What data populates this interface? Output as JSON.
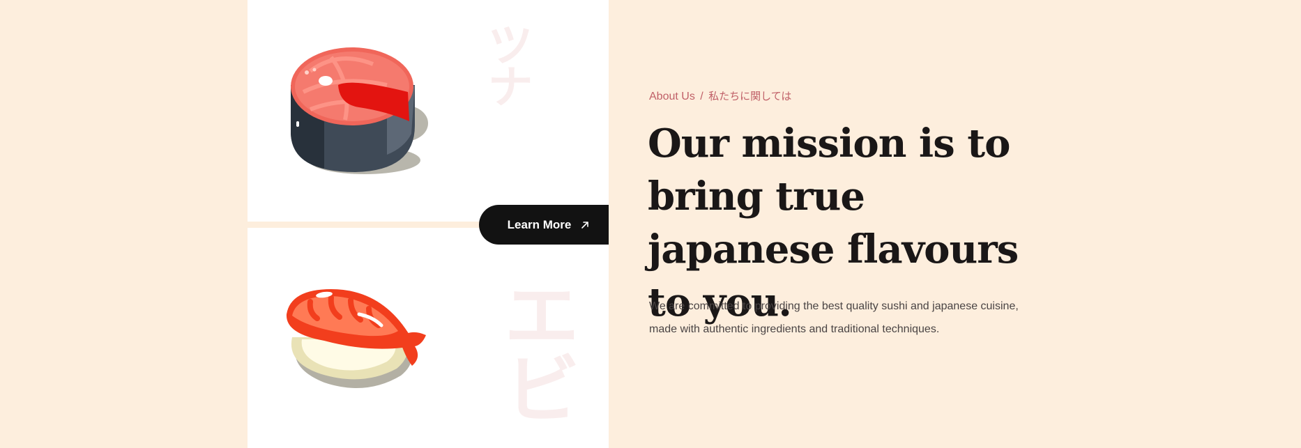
{
  "cards": {
    "top": {
      "kana": "ツナ",
      "food_icon": "tuna-steak-icon"
    },
    "bottom": {
      "kana": "エビ",
      "food_icon": "ebi-nigiri-icon"
    }
  },
  "cta": {
    "label": "Learn More",
    "icon": "arrow-up-right-icon"
  },
  "about": {
    "section": "About Us",
    "separator": "/",
    "section_jp": "私たちに関しては"
  },
  "headline": "Our mission is to bring true japanese flavours to you.",
  "description": "We are committed to providing the best quality sushi and japanese cuisine, made with authentic ingredients and traditional techniques.",
  "colors": {
    "background": "#fdeedd",
    "card": "#ffffff",
    "button": "#121212",
    "accent": "#c06068",
    "heading": "#1a1717"
  }
}
